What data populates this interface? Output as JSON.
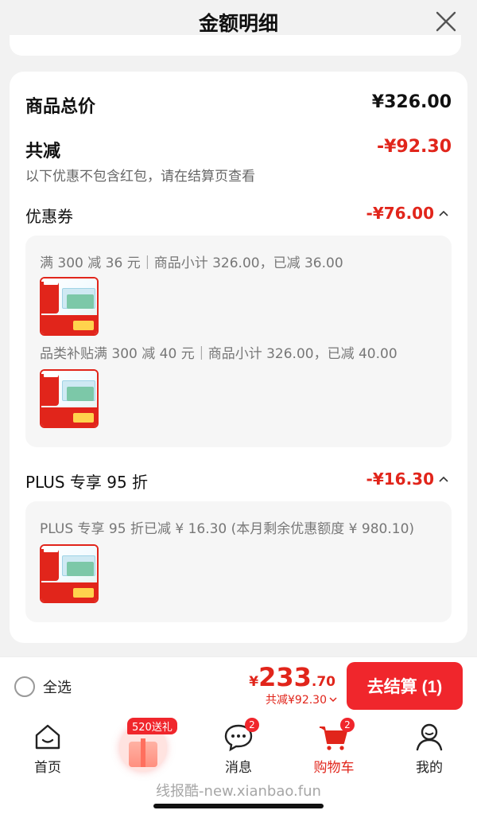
{
  "header": {
    "title": "金额明细"
  },
  "summary": {
    "total_label": "商品总价",
    "total_value": "¥326.00",
    "reduce_label": "共减",
    "reduce_value": "-¥92.30",
    "note": "以下优惠不包含红包，请在结算页查看"
  },
  "coupon_section": {
    "label": "优惠券",
    "value": "-¥76.00",
    "items": [
      {
        "desc": "满 300 减 36 元｜商品小计 326.00，已减 36.00"
      },
      {
        "desc": "品类补贴满 300 减 40 元｜商品小计 326.00，已减 40.00"
      }
    ]
  },
  "plus_section": {
    "label": "PLUS 专享 95 折",
    "value": "-¥16.30",
    "items": [
      {
        "desc": "PLUS 专享 95 折已减 ¥ 16.30 (本月剩余优惠额度 ¥ 980.10)"
      }
    ]
  },
  "bottom_bar": {
    "select_all": "全选",
    "price_currency": "¥",
    "price_int": "233",
    "price_dec": ".70",
    "discount_text": "共减¥92.30",
    "checkout_label": "去结算 (1)"
  },
  "tabbar": {
    "gift_tag": "520送礼",
    "items": [
      {
        "label": "首页"
      },
      {
        "label": "消息",
        "badge": "2"
      },
      {
        "label": "购物车",
        "badge": "2"
      },
      {
        "label": "我的"
      }
    ]
  },
  "watermark": "线报酷-new.xianbao.fun",
  "colors": {
    "accent": "#e1251b",
    "checkout": "#f0262c"
  }
}
